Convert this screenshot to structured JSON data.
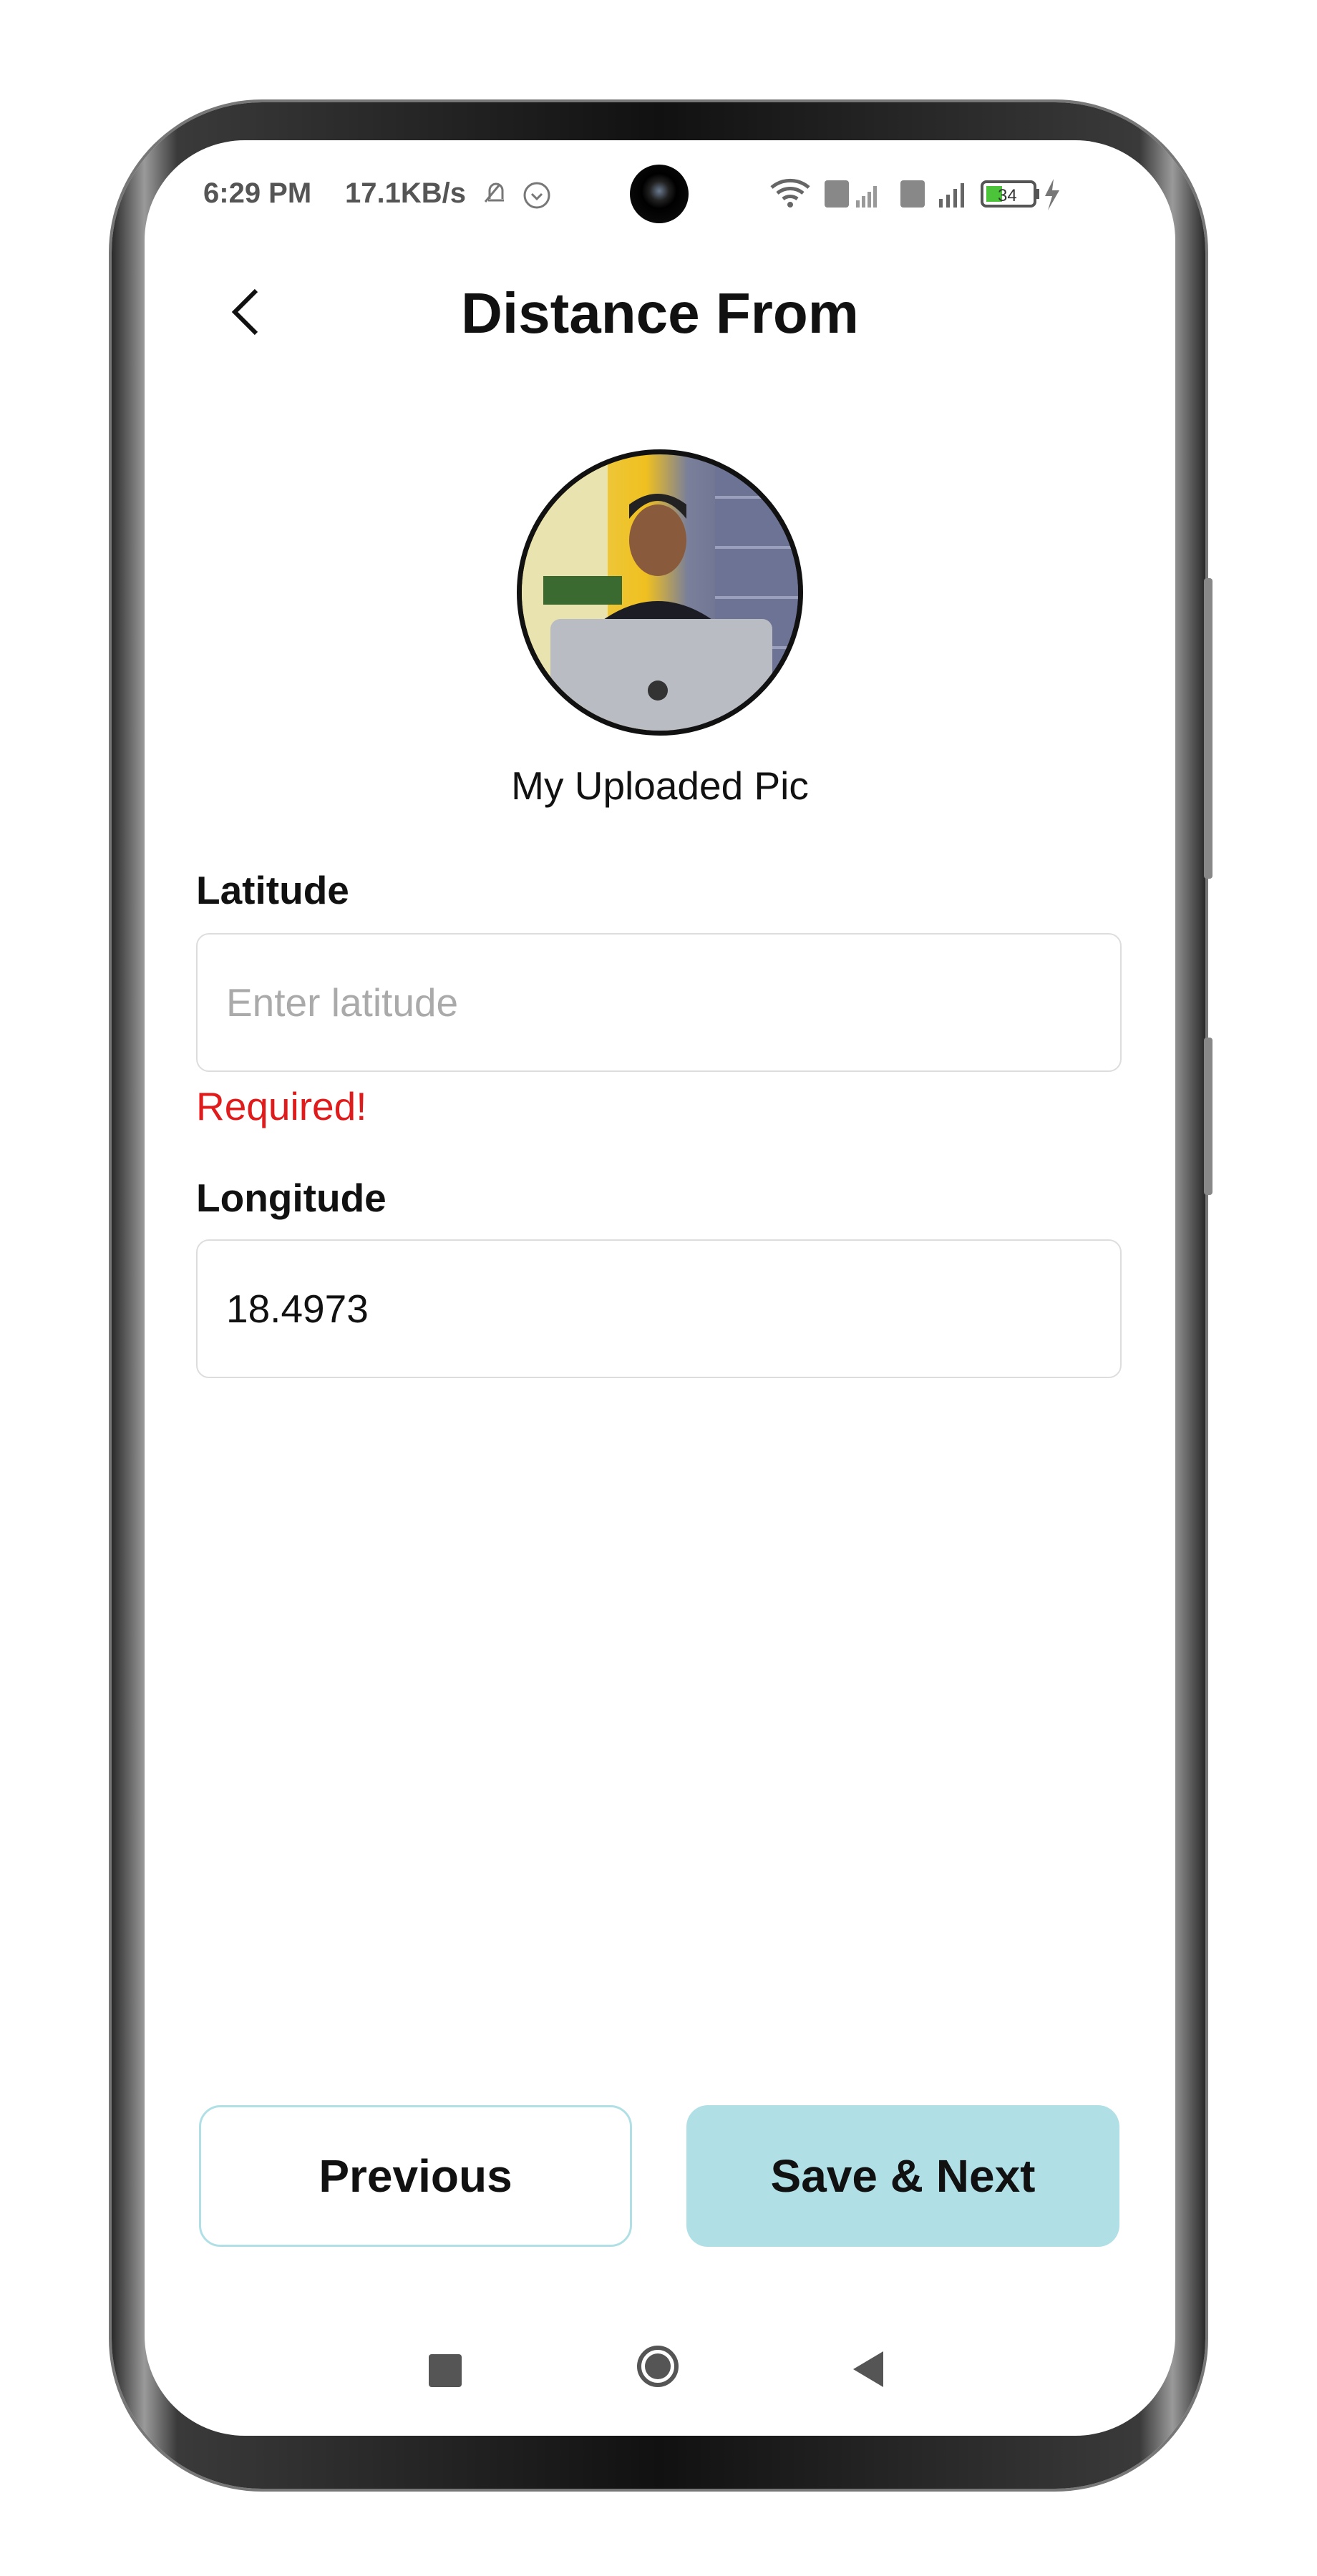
{
  "status_bar": {
    "time": "6:29 PM",
    "speed": "17.1KB/s",
    "battery": "34"
  },
  "header": {
    "title": "Distance From"
  },
  "profile": {
    "caption": "My Uploaded Pic"
  },
  "form": {
    "latitude": {
      "label": "Latitude",
      "value": "",
      "placeholder": "Enter latitude",
      "error": "Required!"
    },
    "longitude": {
      "label": "Longitude",
      "value": "18.4973"
    }
  },
  "buttons": {
    "previous": "Previous",
    "save_next": "Save & Next"
  },
  "colors": {
    "accent": "#b0e0e6",
    "error": "#e01b1b"
  }
}
